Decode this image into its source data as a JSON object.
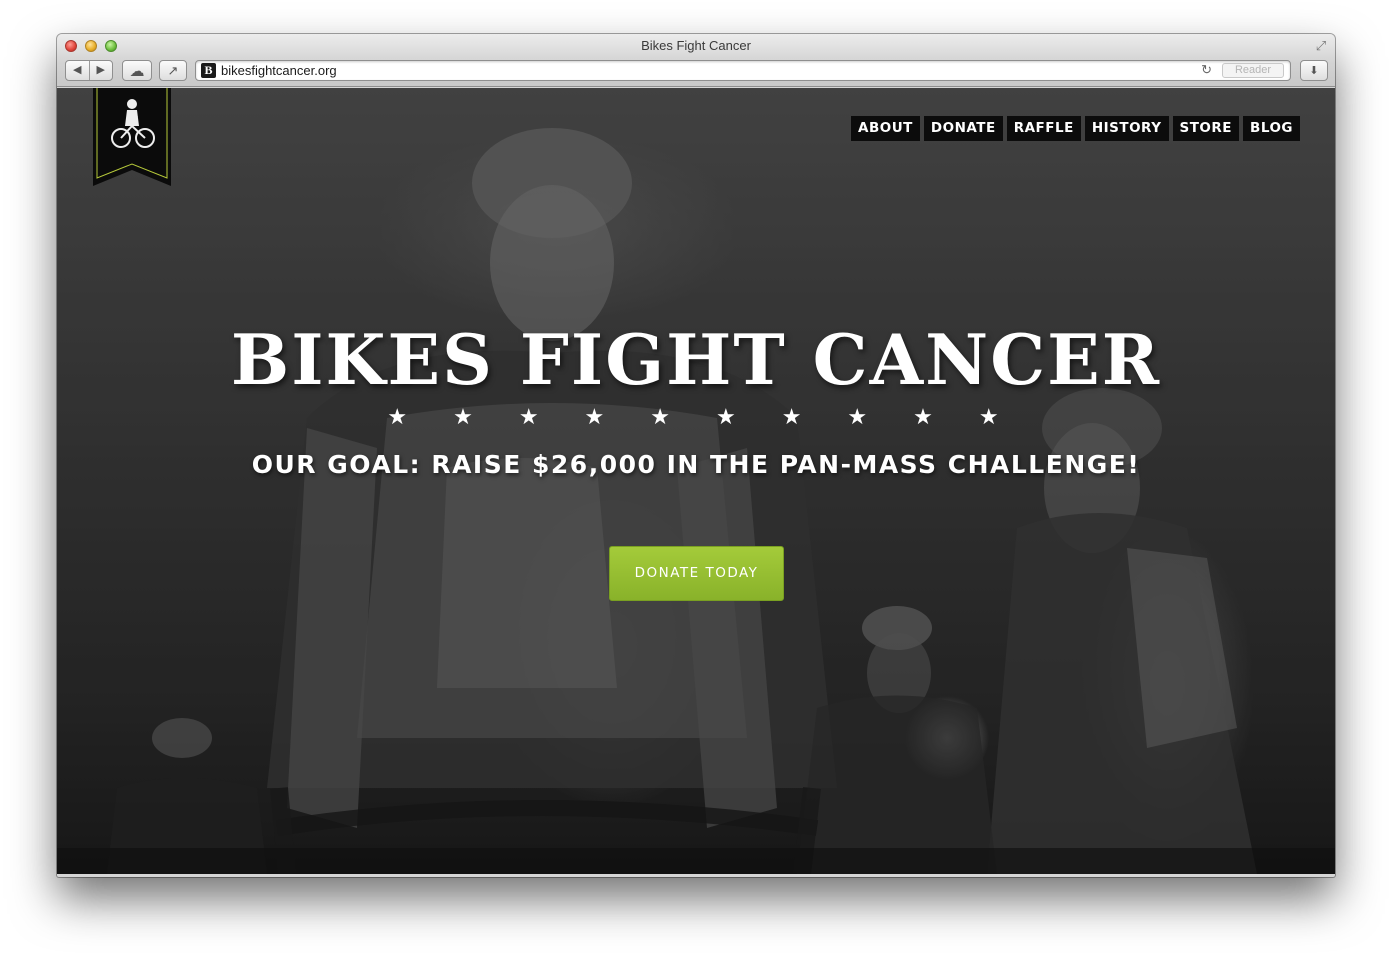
{
  "window": {
    "title": "Bikes Fight Cancer",
    "url": "bikesfightcancer.org",
    "favicon_letter": "B",
    "reader_label": "Reader"
  },
  "icons": {
    "back": "◀",
    "forward": "▶",
    "cloud": "☁",
    "share": "↗",
    "reload": "↻",
    "download": "⬇",
    "fullscreen": "⤢"
  },
  "site": {
    "nav": [
      "ABOUT",
      "DONATE",
      "RAFFLE",
      "HISTORY",
      "STORE",
      "BLOG"
    ],
    "hero_title": "BIKES FIGHT CANCER",
    "stars": "★★★★★★★★★★",
    "goal": "OUR GOAL: RAISE $26,000 IN THE PAN-MASS CHALLENGE!",
    "donate_button": "DONATE TODAY"
  },
  "colors": {
    "accent_green": "#96bd32",
    "nav_bg": "#0c0c0c",
    "banner_border": "#b6c93a"
  }
}
